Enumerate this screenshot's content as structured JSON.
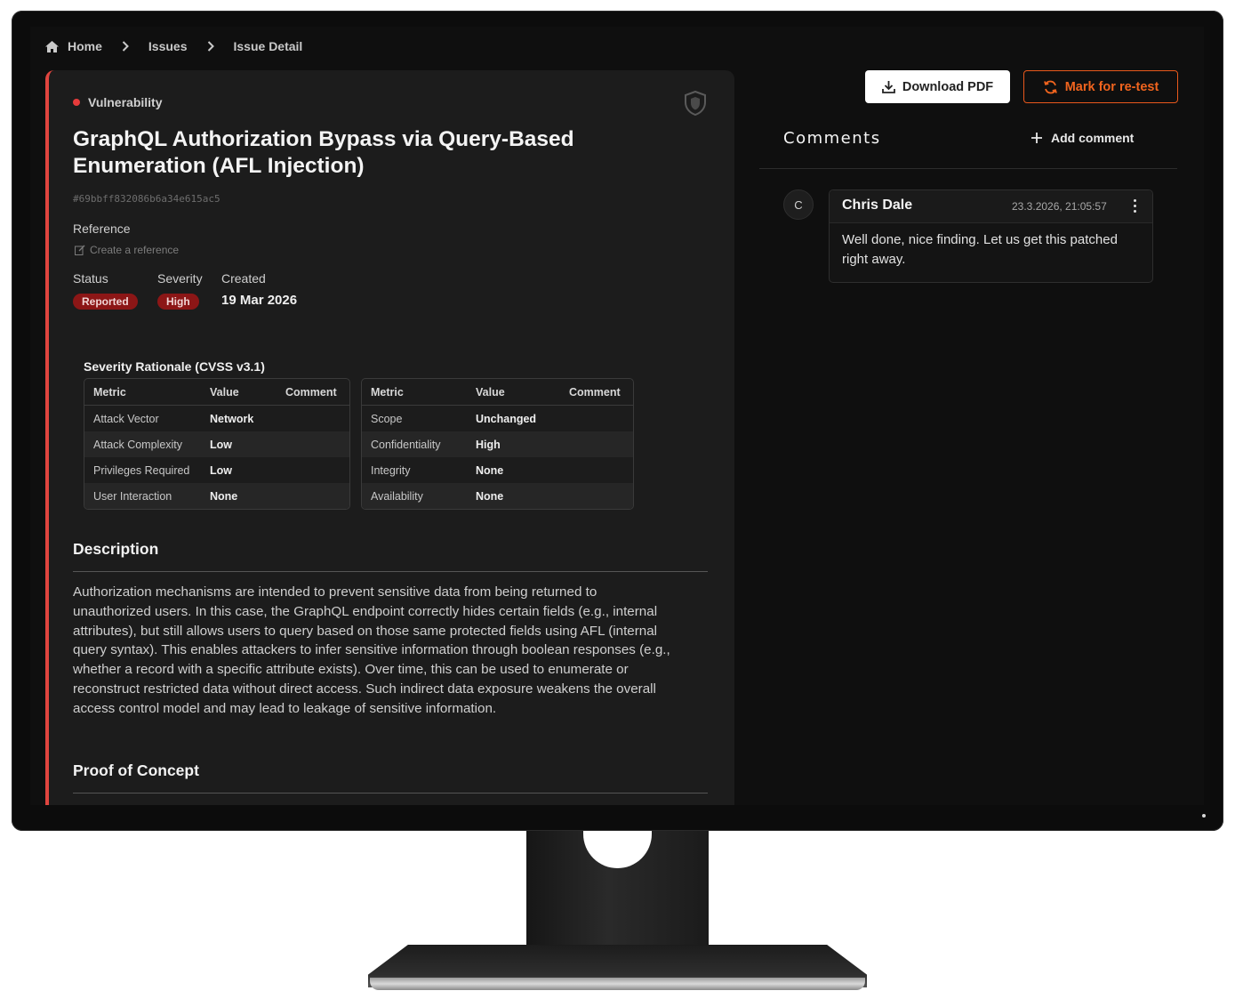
{
  "breadcrumb": {
    "items": [
      "Home",
      "Issues",
      "Issue Detail"
    ]
  },
  "issue": {
    "type": "Vulnerability",
    "title": "GraphQL Authorization Bypass via Query-Based Enumeration (AFL Injection)",
    "hash": "#69bbff832086b6a34e615ac5",
    "reference_label": "Reference",
    "reference_action": "Create a reference",
    "status_label": "Status",
    "status_value": "Reported",
    "severity_label": "Severity",
    "severity_value": "High",
    "created_label": "Created",
    "created_value": "19 Mar 2026",
    "accent_color": "#e0453f",
    "badge_color": "#8c1616"
  },
  "cvss": {
    "title": "Severity Rationale (CVSS v3.1)",
    "columns": [
      "Metric",
      "Value",
      "Comment"
    ],
    "left_rows": [
      {
        "metric": "Attack Vector",
        "value": "Network",
        "comment": ""
      },
      {
        "metric": "Attack Complexity",
        "value": "Low",
        "comment": ""
      },
      {
        "metric": "Privileges Required",
        "value": "Low",
        "comment": ""
      },
      {
        "metric": "User Interaction",
        "value": "None",
        "comment": ""
      }
    ],
    "right_rows": [
      {
        "metric": "Scope",
        "value": "Unchanged",
        "comment": ""
      },
      {
        "metric": "Confidentiality",
        "value": "High",
        "comment": ""
      },
      {
        "metric": "Integrity",
        "value": "None",
        "comment": ""
      },
      {
        "metric": "Availability",
        "value": "None",
        "comment": ""
      }
    ]
  },
  "description": {
    "heading": "Description",
    "text": "Authorization mechanisms are intended to prevent sensitive data from being returned to unauthorized users. In this case, the GraphQL endpoint correctly hides certain fields (e.g., internal attributes), but still allows users to query based on those same protected fields using AFL (internal query syntax). This enables attackers to infer sensitive information through boolean responses (e.g., whether a record with a specific attribute exists). Over time, this can be used to enumerate or reconstruct restricted data without direct access. Such indirect data exposure weakens the overall access control model and may lead to leakage of sensitive information."
  },
  "poc": {
    "heading": "Proof of Concept"
  },
  "actions": {
    "download_pdf": "Download PDF",
    "mark_retest": "Mark for re-test",
    "retest_color": "#e8581c"
  },
  "comments": {
    "title": "Comments",
    "add_label": "Add comment",
    "items": [
      {
        "avatar": "C",
        "author": "Chris Dale",
        "timestamp": "23.3.2026, 21:05:57",
        "body": "Well done, nice finding. Let us get this patched right away."
      }
    ]
  },
  "icons": {
    "home": "home-icon",
    "chevron": "chevron-right-icon",
    "shield": "shield-icon",
    "edit": "edit-icon",
    "download": "download-icon",
    "refresh": "refresh-icon",
    "plus": "plus-icon",
    "kebab": "kebab-icon"
  }
}
